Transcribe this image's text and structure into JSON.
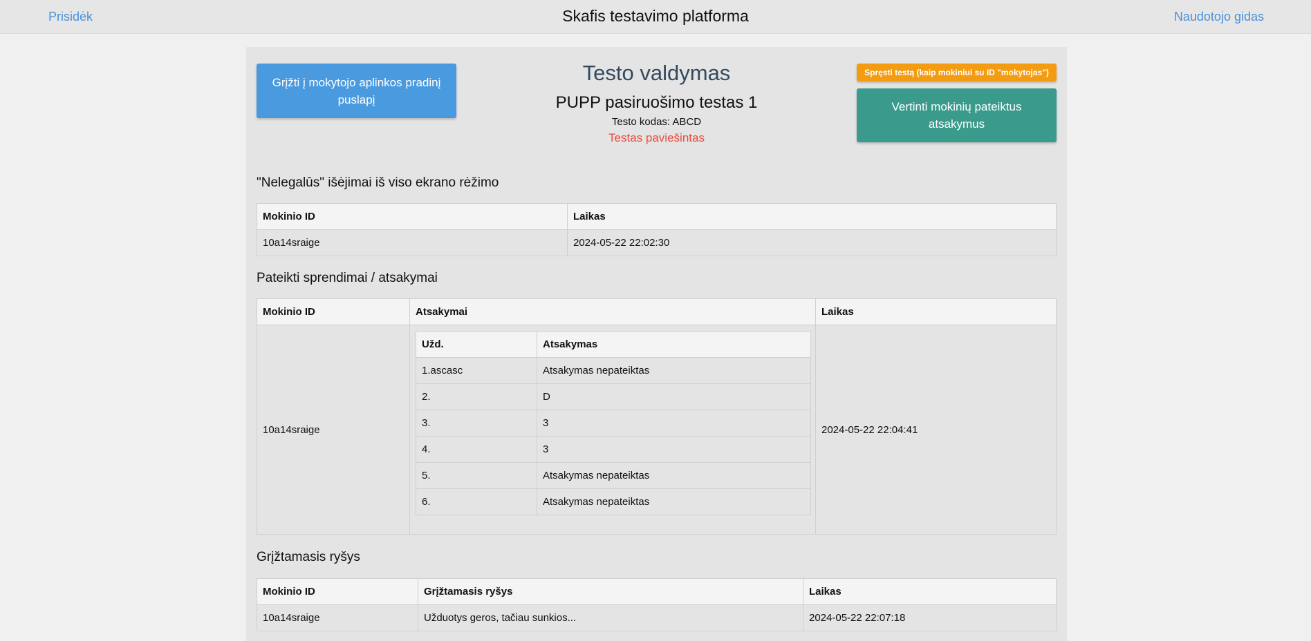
{
  "topbar": {
    "left_link": "Prisidėk",
    "title": "Skafis testavimo platforma",
    "right_link": "Naudotojo gidas"
  },
  "header": {
    "back_button": "Grįžti į mokytojo aplinkos pradinį puslapį",
    "title": "Testo valdymas",
    "test_name": "PUPP pasiruošimo testas 1",
    "test_code": "Testo kodas: ABCD",
    "status": "Testas paviešintas",
    "solve_button": "Spręsti testą (kaip mokiniui su ID \"mokytojas\")",
    "grade_button": "Vertinti mokinių pateiktus atsakymus",
    "status_color": "#e74c3c"
  },
  "exits": {
    "title": "\"Nelegalūs\" išėjimai iš viso ekrano rėžimo",
    "headers": [
      "Mokinio ID",
      "Laikas"
    ],
    "rows": [
      {
        "id": "10a14sraige",
        "time": "2024-05-22 22:02:30"
      }
    ]
  },
  "submissions": {
    "title": "Pateikti sprendimai / atsakymai",
    "headers": [
      "Mokinio ID",
      "Atsakymai",
      "Laikas"
    ],
    "inner_headers": [
      "Užd.",
      "Atsakymas"
    ],
    "rows": [
      {
        "id": "10a14sraige",
        "time": "2024-05-22 22:04:41",
        "answers": [
          {
            "task": "1.ascasc",
            "answer": "Atsakymas nepateiktas"
          },
          {
            "task": "2.",
            "answer": "D"
          },
          {
            "task": "3.",
            "answer": "3"
          },
          {
            "task": "4.",
            "answer": "3"
          },
          {
            "task": "5.",
            "answer": "Atsakymas nepateiktas"
          },
          {
            "task": "6.",
            "answer": "Atsakymas nepateiktas"
          }
        ]
      }
    ]
  },
  "feedback": {
    "title": "Grįžtamasis ryšys",
    "headers": [
      "Mokinio ID",
      "Grįžtamasis ryšys",
      "Laikas"
    ],
    "rows": [
      {
        "id": "10a14sraige",
        "text": "Užduotys geros, tačiau sunkios...",
        "time": "2024-05-22 22:07:18"
      }
    ]
  }
}
